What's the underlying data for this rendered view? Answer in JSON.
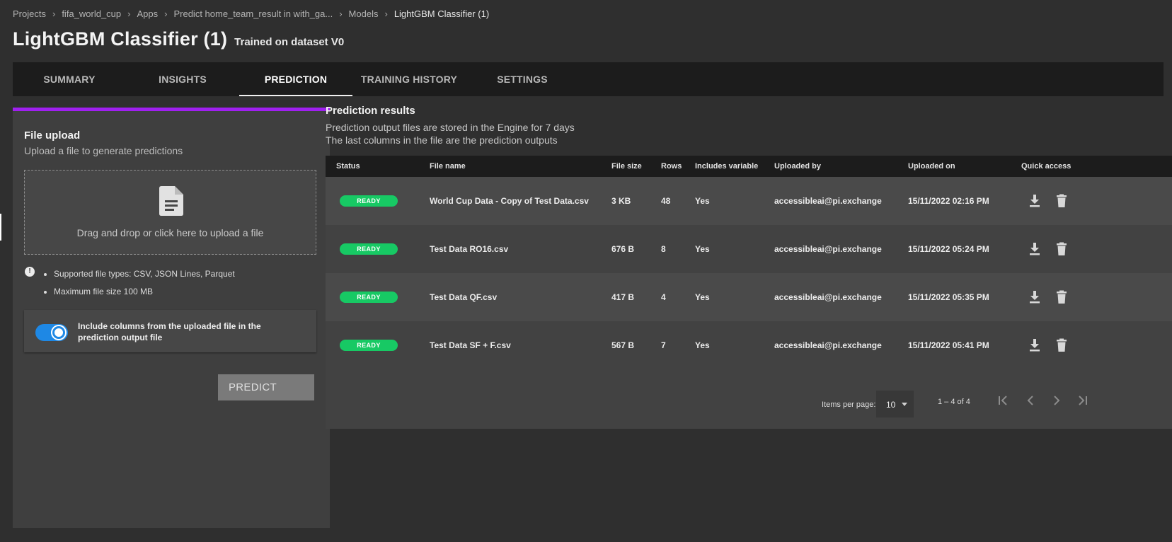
{
  "breadcrumb": {
    "items": [
      "Projects",
      "fifa_world_cup",
      "Apps",
      "Predict home_team_result in with_ga...",
      "Models",
      "LightGBM Classifier (1)"
    ]
  },
  "header": {
    "title": "LightGBM Classifier (1)",
    "subtitle": "Trained on dataset V0"
  },
  "tabs": [
    "SUMMARY",
    "INSIGHTS",
    "PREDICTION",
    "TRAINING HISTORY",
    "SETTINGS"
  ],
  "active_tab": "PREDICTION",
  "upload": {
    "title": "File upload",
    "subtitle": "Upload a file to generate predictions",
    "drop_text": "Drag and drop or click here to upload a file",
    "info_items": [
      "Supported file types: CSV, JSON Lines, Parquet",
      "Maximum file size 100 MB"
    ],
    "include_label": "Include columns from the uploaded file in the prediction output file",
    "include_enabled": true,
    "predict_label": "PREDICT"
  },
  "results": {
    "title": "Prediction results",
    "desc_line1": "Prediction output files are stored in the Engine for 7 days",
    "desc_line2": "The last columns in the file are the prediction outputs",
    "columns": {
      "status": "Status",
      "file_name": "File name",
      "file_size": "File size",
      "rows": "Rows",
      "includes": "Includes variable",
      "uploaded_by": "Uploaded by",
      "uploaded_on": "Uploaded on",
      "quick_access": "Quick access"
    },
    "rows": [
      {
        "status": "READY",
        "file_name": "World Cup Data - Copy of Test Data.csv",
        "file_size": "3 KB",
        "rows": "48",
        "includes": "Yes",
        "uploaded_by": "accessibleai@pi.exchange",
        "uploaded_on": "15/11/2022 02:16 PM"
      },
      {
        "status": "READY",
        "file_name": "Test Data RO16.csv",
        "file_size": "676 B",
        "rows": "8",
        "includes": "Yes",
        "uploaded_by": "accessibleai@pi.exchange",
        "uploaded_on": "15/11/2022 05:24 PM"
      },
      {
        "status": "READY",
        "file_name": "Test Data QF.csv",
        "file_size": "417 B",
        "rows": "4",
        "includes": "Yes",
        "uploaded_by": "accessibleai@pi.exchange",
        "uploaded_on": "15/11/2022 05:35 PM"
      },
      {
        "status": "READY",
        "file_name": "Test Data SF + F.csv",
        "file_size": "567 B",
        "rows": "7",
        "includes": "Yes",
        "uploaded_by": "accessibleai@pi.exchange",
        "uploaded_on": "15/11/2022 05:41 PM"
      }
    ],
    "pagination": {
      "items_per_page_label": "Items per page:",
      "items_per_page": "10",
      "range": "1 – 4 of 4"
    }
  },
  "colors": {
    "accent": "#a020f0",
    "ready": "#17c964",
    "toggle": "#1e88e5"
  },
  "icons": [
    "chevron-right-icon",
    "document-icon",
    "info-icon",
    "download-icon",
    "trash-icon",
    "first-page-icon",
    "previous-page-icon",
    "next-page-icon",
    "last-page-icon"
  ]
}
